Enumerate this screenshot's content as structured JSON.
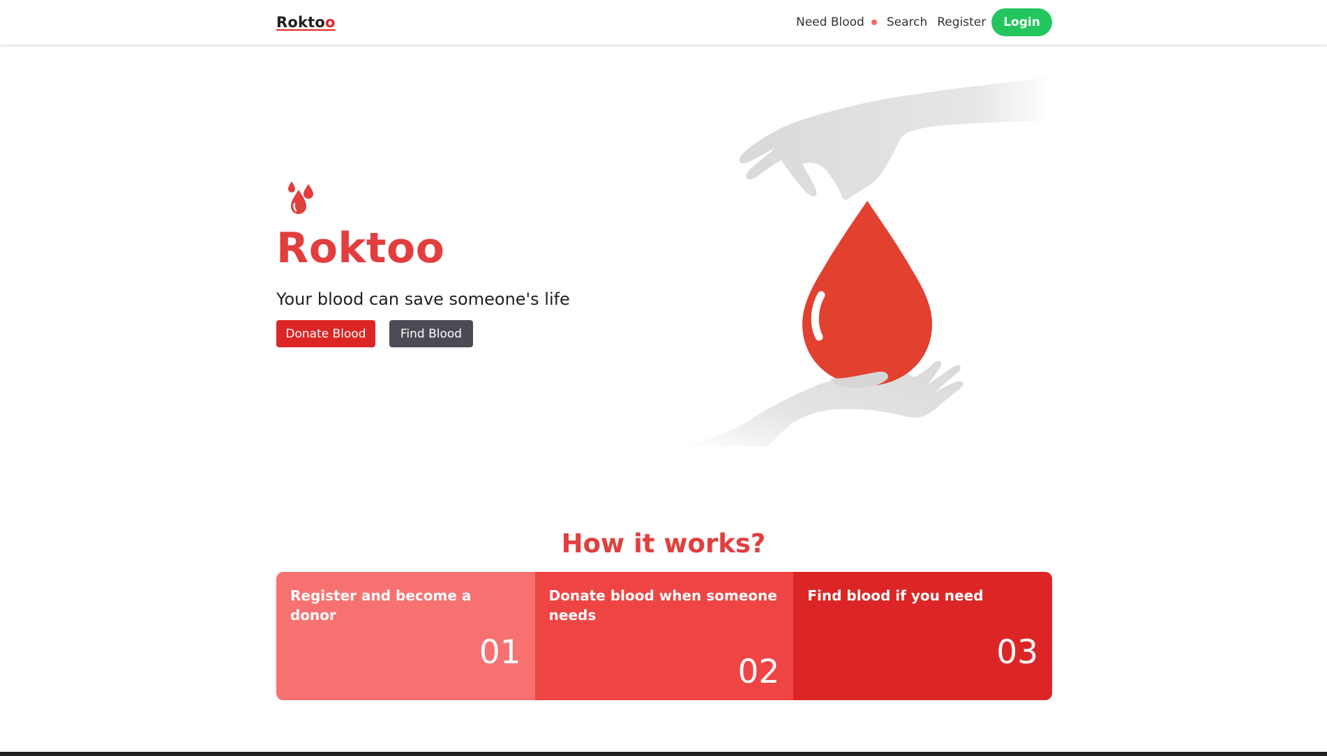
{
  "nav": {
    "brand_main": "Rokto",
    "brand_accent": "o",
    "links": [
      "Need Blood",
      "Search",
      "Register"
    ],
    "login": "Login"
  },
  "hero": {
    "title": "Roktoo",
    "tagline": "Your blood can save someone's life",
    "donate_button": "Donate Blood",
    "find_button": "Find Blood"
  },
  "how": {
    "title": "How it works?",
    "steps": [
      {
        "title": "Register and become a donor",
        "number": "01"
      },
      {
        "title": "Donate blood when someone needs",
        "number": "02"
      },
      {
        "title": "Find blood if you need",
        "number": "03"
      }
    ]
  },
  "colors": {
    "brand_red": "#e33e3e",
    "login_green": "#22c55e",
    "step_1": "#f87171",
    "step_2": "#ef4444",
    "step_3": "#dc2626"
  },
  "icons": [
    "blood-drops-icon",
    "hands-blood-drop-illustration"
  ]
}
